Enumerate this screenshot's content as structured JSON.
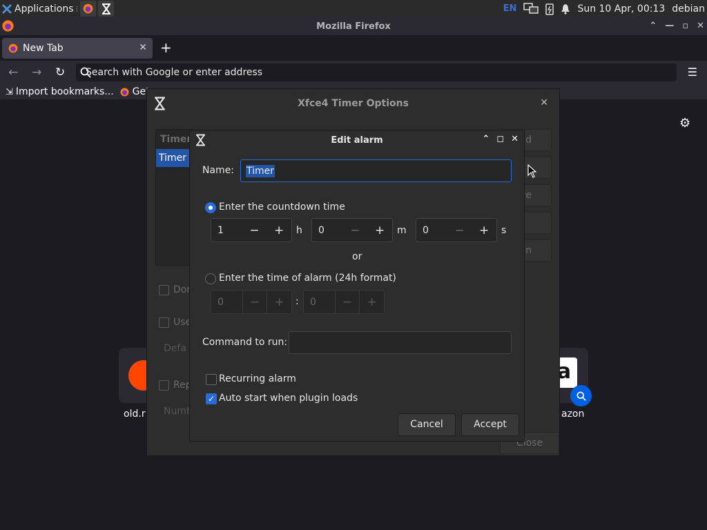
{
  "panel": {
    "applications_label": "Applications",
    "lang": "EN",
    "datetime": "Sun 10 Apr, 00:13",
    "user": "debian"
  },
  "firefox": {
    "window_title": "Mozilla Firefox",
    "tab_title": "New Tab",
    "url_placeholder": "Search with Google or enter address",
    "bookmarks": [
      "Import bookmarks...",
      "Get"
    ]
  },
  "newtab_page": {
    "tiles": [
      "old.r",
      "azon"
    ]
  },
  "options_dialog": {
    "title": "Xfce4 Timer Options",
    "list_header": "Timer",
    "list_selected": "Timer",
    "side_buttons": [
      "d",
      "",
      "ove",
      "",
      "n"
    ],
    "checkboxes": [
      "Don",
      "Use",
      "Rep"
    ],
    "faded_labels": [
      "Defa",
      "Numb"
    ],
    "close_label": "Close"
  },
  "alarm_dialog": {
    "title": "Edit alarm",
    "name_label": "Name:",
    "name_value": "Timer",
    "countdown_label": "Enter the countdown time",
    "countdown_selected": true,
    "hours": "1",
    "minutes": "0",
    "seconds": "0",
    "unit_h": "h",
    "unit_m": "m",
    "unit_s": "s",
    "or_label": "or",
    "alarm_time_label": "Enter the time of alarm (24h format)",
    "alarm_hours": "0",
    "alarm_minutes": "0",
    "colon": ":",
    "command_label": "Command to run:",
    "command_value": "",
    "recurring_label": "Recurring alarm",
    "recurring_checked": false,
    "autostart_label": "Auto start when plugin loads",
    "autostart_checked": true,
    "cancel_label": "Cancel",
    "accept_label": "Accept"
  }
}
